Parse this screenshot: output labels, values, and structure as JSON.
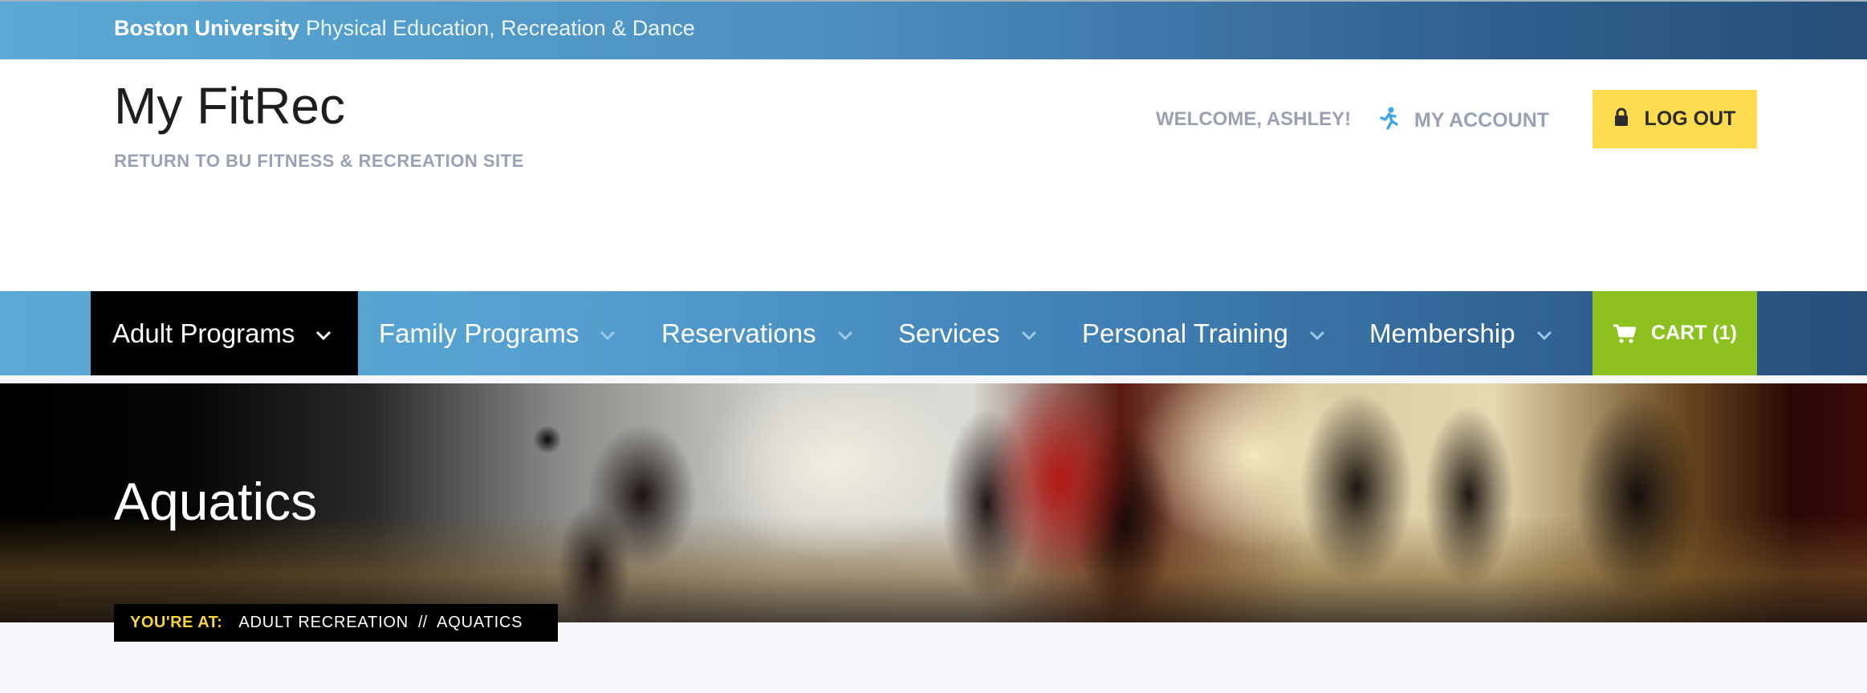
{
  "topbar": {
    "university": "Boston University",
    "department": "Physical Education, Recreation & Dance"
  },
  "header": {
    "site_title": "My FitRec",
    "return_link": "RETURN TO BU FITNESS & RECREATION SITE",
    "welcome": "WELCOME, ASHLEY!",
    "account_label": "MY ACCOUNT",
    "account_icon": "runner-icon",
    "logout_label": "LOG OUT",
    "logout_icon": "lock-icon"
  },
  "nav": {
    "items": [
      {
        "label": "Adult Programs",
        "active": true
      },
      {
        "label": "Family Programs",
        "active": false
      },
      {
        "label": "Reservations",
        "active": false
      },
      {
        "label": "Services",
        "active": false
      },
      {
        "label": "Personal Training",
        "active": false
      },
      {
        "label": "Membership",
        "active": false
      }
    ],
    "cart_label": "CART (1)",
    "cart_icon": "cart-icon"
  },
  "hero": {
    "title": "Aquatics"
  },
  "breadcrumb": {
    "label": "YOU'RE AT:",
    "items": [
      "ADULT RECREATION",
      "AQUATICS"
    ],
    "separator": "//"
  },
  "colors": {
    "accent_yellow": "#fddc4f",
    "cart_green": "#8cc11f",
    "nav_blue": "#5aa9d6",
    "nav_dark_blue": "#274f7a"
  }
}
